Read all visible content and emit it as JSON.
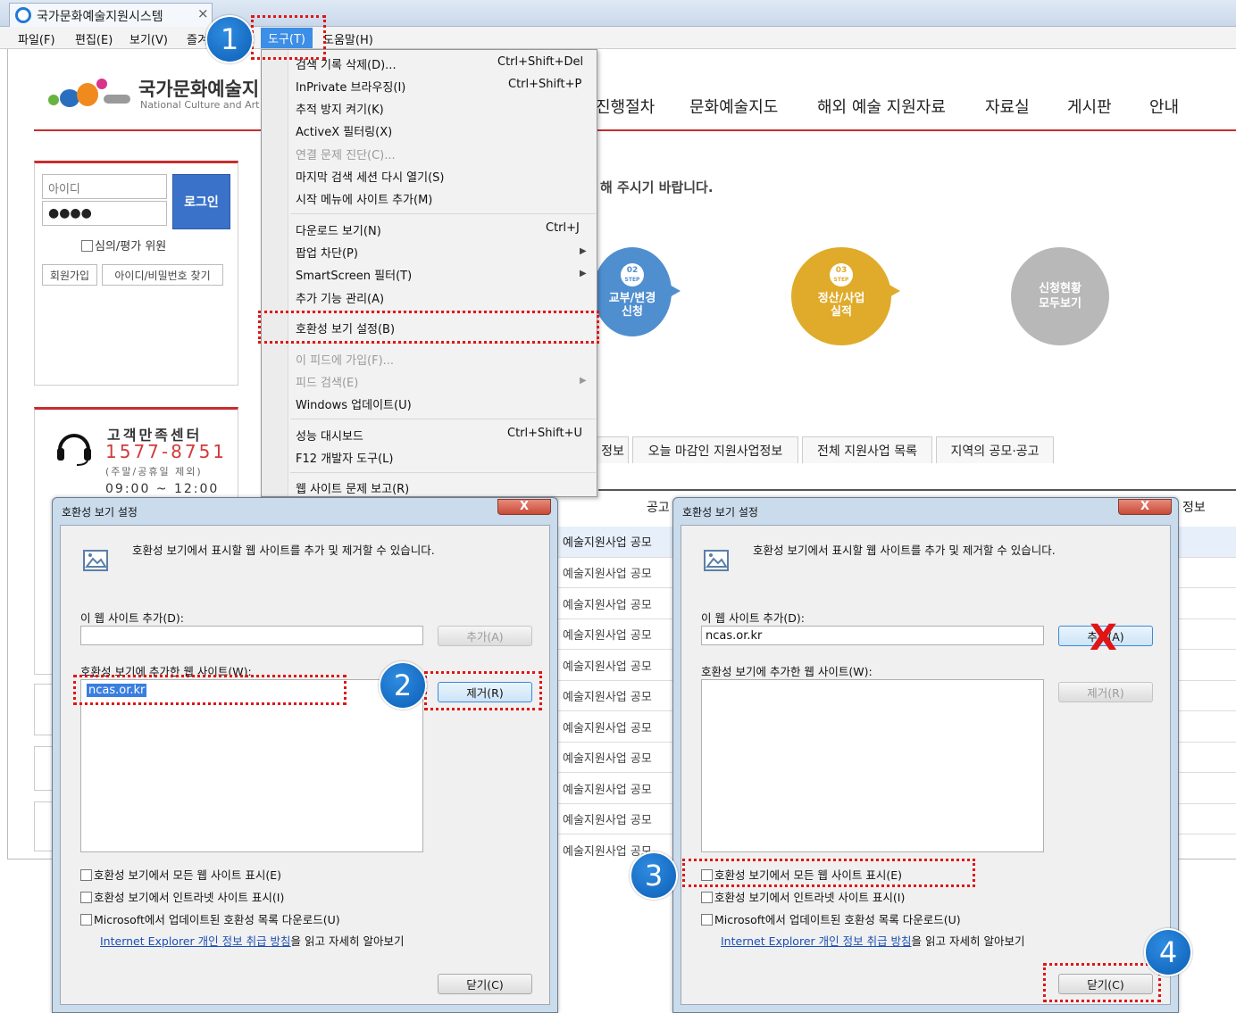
{
  "browser": {
    "tab_title": "국가문화예술지원시스템",
    "tab_close": "×",
    "menu": [
      "파일(F)",
      "편집(E)",
      "보기(V)",
      "즐겨",
      "도구(T)",
      "도움말(H)"
    ]
  },
  "site": {
    "title": "국가문화예술지",
    "subtitle": "National Culture and Art",
    "nav": [
      "진행절차",
      "문화예술지도",
      "해외 예술 지원자료",
      "자료실",
      "게시판",
      "안내"
    ],
    "login": {
      "id_placeholder": "아이디",
      "pw_value": "●●●●",
      "login_button": "로그인",
      "reviewer_label": "심의/평가 위원",
      "signup": "회원가입",
      "find": "아이디/비밀번호 찾기"
    },
    "customer_center": {
      "title": "고객만족센터",
      "phone": "1577-8751",
      "note": "(주말/공휴일 제외)",
      "hours": "09:00 ~ 12:00"
    },
    "notice": "해 주시기 바랍니다.",
    "steps": [
      {
        "num": "02",
        "step": "STEP",
        "label": "교부/변경\n신청",
        "color": "#4f8fd0"
      },
      {
        "num": "03",
        "step": "STEP",
        "label": "정산/사업\n실적",
        "color": "#e0ab2a"
      },
      {
        "num": "",
        "step": "",
        "label": "신청현황\n모두보기",
        "color": "#b8b8b8"
      }
    ],
    "tabs": [
      "정보",
      "오늘 마감인 지원사업정보",
      "전체 지원사업 목록",
      "지역의 공모·공고"
    ],
    "table_header": "공고",
    "table_header_right": "정보",
    "rows": [
      "예술지원사업 공모",
      "예술지원사업 공모",
      "예술지원사업 공모",
      "예술지원사업 공모",
      "예술지원사업 공모",
      "예술지원사업 공모",
      "예술지원사업 공모",
      "예술지원사업 공모",
      "예술지원사업 공모",
      "예술지원사업 공모",
      "예술지원사업 공모"
    ]
  },
  "tools_menu": {
    "items": [
      {
        "label": "검색 기록 삭제(D)...",
        "shortcut": "Ctrl+Shift+Del"
      },
      {
        "label": "InPrivate 브라우징(I)",
        "shortcut": "Ctrl+Shift+P"
      },
      {
        "label": "추적 방지 켜기(K)",
        "shortcut": ""
      },
      {
        "label": "ActiveX 필터링(X)",
        "shortcut": ""
      },
      {
        "label": "연결 문제 진단(C)...",
        "shortcut": ""
      },
      {
        "label": "마지막 검색 세션 다시 열기(S)",
        "shortcut": ""
      },
      {
        "label": "시작 메뉴에 사이트 추가(M)",
        "shortcut": ""
      },
      {
        "label": "다운로드 보기(N)",
        "shortcut": "Ctrl+J"
      },
      {
        "label": "팝업 차단(P)",
        "shortcut": ""
      },
      {
        "label": "SmartScreen 필터(T)",
        "shortcut": ""
      },
      {
        "label": "추가 기능 관리(A)",
        "shortcut": ""
      },
      {
        "label": "호환성 보기 설정(B)",
        "shortcut": ""
      },
      {
        "label": "이 피드에 가입(F)...",
        "shortcut": ""
      },
      {
        "label": "피드 검색(E)",
        "shortcut": ""
      },
      {
        "label": "Windows 업데이트(U)",
        "shortcut": ""
      },
      {
        "label": "성능 대시보드",
        "shortcut": "Ctrl+Shift+U"
      },
      {
        "label": "F12 개발자 도구(L)",
        "shortcut": ""
      },
      {
        "label": "웹 사이트 문제 보고(R)",
        "shortcut": ""
      }
    ]
  },
  "dialog": {
    "title": "호환성 보기 설정",
    "close": "X",
    "description": "호환성 보기에서 표시할 웹 사이트를 추가 및 제거할 수 있습니다.",
    "add_label": "이 웹 사이트 추가(D):",
    "add_button": "추가(A)",
    "list_label": "호환성 보기에 추가한 웹 사이트(W):",
    "remove_button": "제거(R)",
    "opt1": "호환성 보기에서 모든 웹 사이트 표시(E)",
    "opt2": "호환성 보기에서 인트라넷 사이트 표시(I)",
    "opt3": "Microsoft에서 업데이트된 호환성 목록 다운로드(U)",
    "link_text": "Internet Explorer 개인 정보 취급 방침",
    "link_suffix": "을 읽고 자세히 알아보기",
    "close_button": "닫기(C)",
    "left_site": "ncas.or.kr",
    "right_input": "ncas.or.kr"
  },
  "annotations": {
    "badges": [
      "1",
      "2",
      "3",
      "4"
    ],
    "x_mark": "X"
  }
}
